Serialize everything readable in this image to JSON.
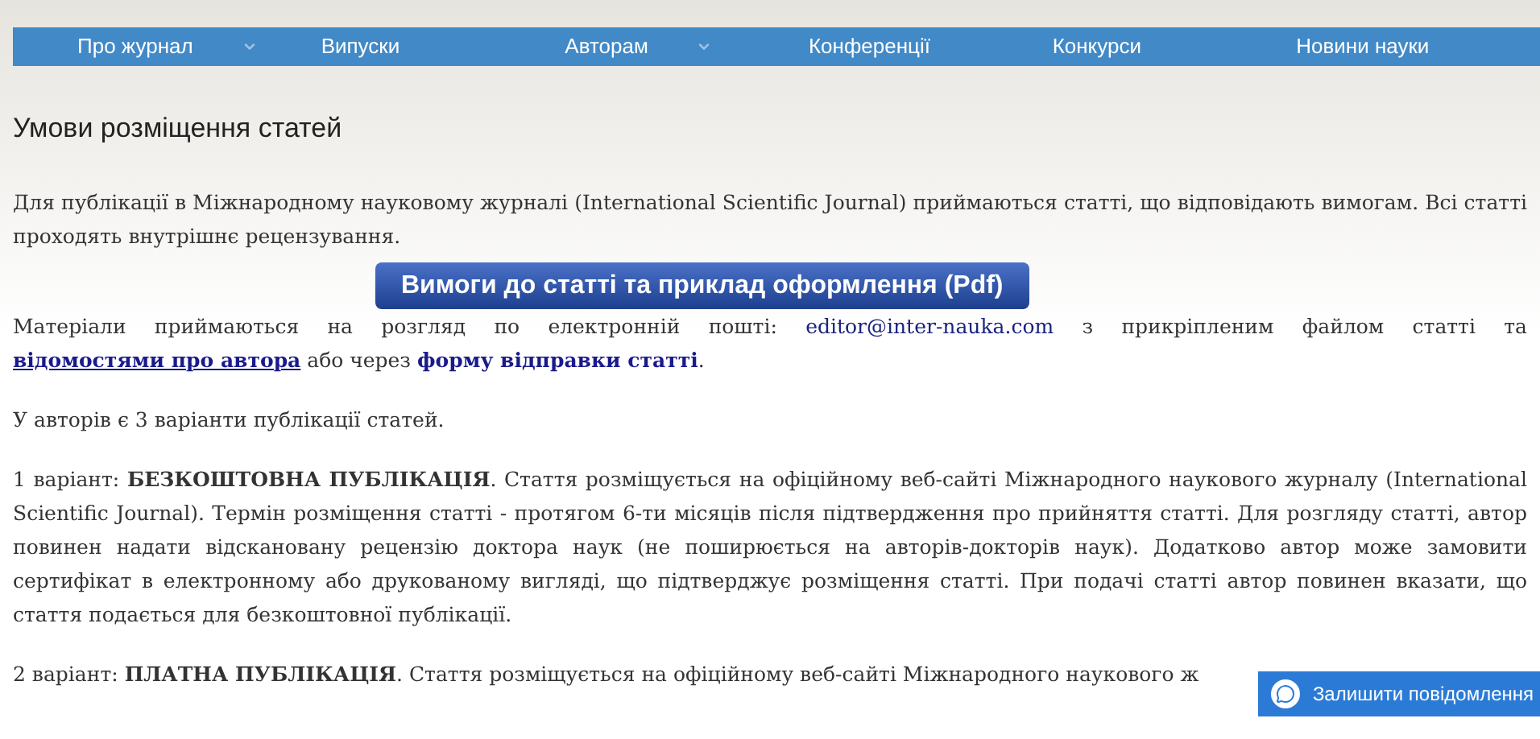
{
  "nav": [
    {
      "label": "Про журнал",
      "dropdown": true
    },
    {
      "label": "Випуски",
      "dropdown": false
    },
    {
      "label": "Авторам",
      "dropdown": true
    },
    {
      "label": "Конференції",
      "dropdown": false
    },
    {
      "label": "Конкурси",
      "dropdown": false
    },
    {
      "label": "Новини науки",
      "dropdown": false
    }
  ],
  "title": "Умови розміщення статей",
  "intro": "Для публікації в Міжнародному науковому журналі (International Scientific Journal) приймаються статті, що відповідають вимогам. Всі статті проходять внутрішнє рецензування.",
  "pdf_button": "Вимоги до статті та приклад оформлення (Pdf)",
  "submission": {
    "before": "Матеріали приймаються на розгляд по електронній пошті:",
    "email": "editor@inter-nauka.com",
    "middle": "з прикріпленим файлом статті та",
    "author_link": "відомостями про автора",
    "or": "або через",
    "form_link": "форму відправки статті",
    "end": "."
  },
  "variants_intro": "У авторів є 3 варіанти публікації статей.",
  "variants": [
    "1 варіант: **БЕЗКОШТОВНА ПУБЛІКАЦІЯ**. Стаття розміщується на офіційному веб-сайті Міжнародного наукового журналу (International Scientific Journal). Термін розміщення статті - протягом 6-ти місяців після підтвердження про прийняття статті. Для розгляду статті, автор повинен надати відскановану рецензію доктора наук (не поширюється на авторів-докторів наук). Додатково автор може замовити сертифікат в електронному або друкованому вигляді, що підтверджує розміщення статті. При подачі статті автор повинен вказати, що стаття подається для безкоштовної публікації.",
    "2 варіант: **ПЛАТНА ПУБЛІКАЦІЯ**. Стаття розміщується на офіційному веб-сайті Міжнародного наукового ж"
  ],
  "chat_widget": "Залишити повідомлення"
}
